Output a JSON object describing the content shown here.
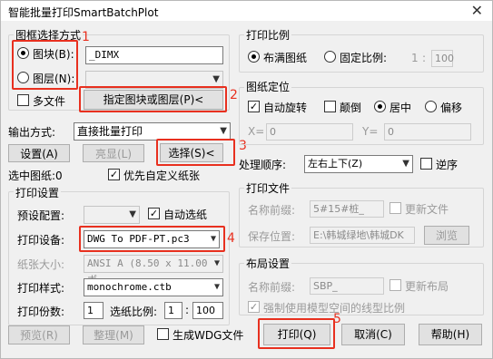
{
  "title": "智能批量打印SmartBatchPlot",
  "frame_select": {
    "title": "图框选择方式",
    "block_label": "图块(B):",
    "layer_label": "图层(N):",
    "block_value": "_DIMX",
    "multi_file_label": "多文件",
    "specify_btn": "指定图块或图层(P)<"
  },
  "output": {
    "label": "输出方式:",
    "value": "直接批量打印",
    "setup_btn": "设置(A)",
    "highlight_btn": "亮显(L)",
    "select_btn": "选择(S)<",
    "selected_text": "选中图纸:0",
    "priority_label": "优先自定义纸张"
  },
  "print_settings": {
    "title": "打印设置",
    "preset_label": "预设配置:",
    "auto_paper_label": "自动选纸",
    "device_label": "打印设备:",
    "device_value": "DWG To PDF-PT.pc3",
    "paper_label": "纸张大小:",
    "paper_value": "ANSI A (8.50 x 11.00 ボ",
    "style_label": "打印样式:",
    "style_value": "monochrome.ctb",
    "copies_label": "打印份数:",
    "copies_value": "1",
    "scale_label": "选纸比例:",
    "scale_a": "1",
    "scale_sep": ":",
    "scale_b": "100"
  },
  "bottom": {
    "preview_btn": "预览(R)",
    "arrange_btn": "整理(M)",
    "gen_dwg_label": "生成WDG文件",
    "print_btn": "打印(Q)",
    "cancel_btn": "取消(C)",
    "help_btn": "帮助(H)"
  },
  "ratio": {
    "title": "打印比例",
    "fit_label": "布满图纸",
    "fixed_label": "固定比例:",
    "a": "1",
    "sep": ":",
    "b": "100"
  },
  "position": {
    "title": "图纸定位",
    "auto_rotate": "自动旋转",
    "flip": "颠倒",
    "center": "居中",
    "offset": "偏移",
    "x_label": "X=",
    "x_value": "0",
    "y_label": "Y=",
    "y_value": "0"
  },
  "order": {
    "label": "处理顺序:",
    "value": "左右上下(Z)",
    "reverse_label": "逆序"
  },
  "print_file": {
    "title": "打印文件",
    "prefix_label": "名称前缀:",
    "prefix_value": "5#15#桩_",
    "update_label": "更新文件",
    "path_label": "保存位置:",
    "path_value": "E:\\韩城绿地\\韩城DK",
    "browse_btn": "浏览"
  },
  "layout": {
    "title": "布局设置",
    "prefix_label": "名称前缀:",
    "prefix_value": "SBP_",
    "update_label": "更新布局",
    "force_label": "强制使用模型空间的线型比例"
  },
  "annotations": [
    "1",
    "2",
    "3",
    "4",
    "5"
  ],
  "accent_color": "#e8301f"
}
